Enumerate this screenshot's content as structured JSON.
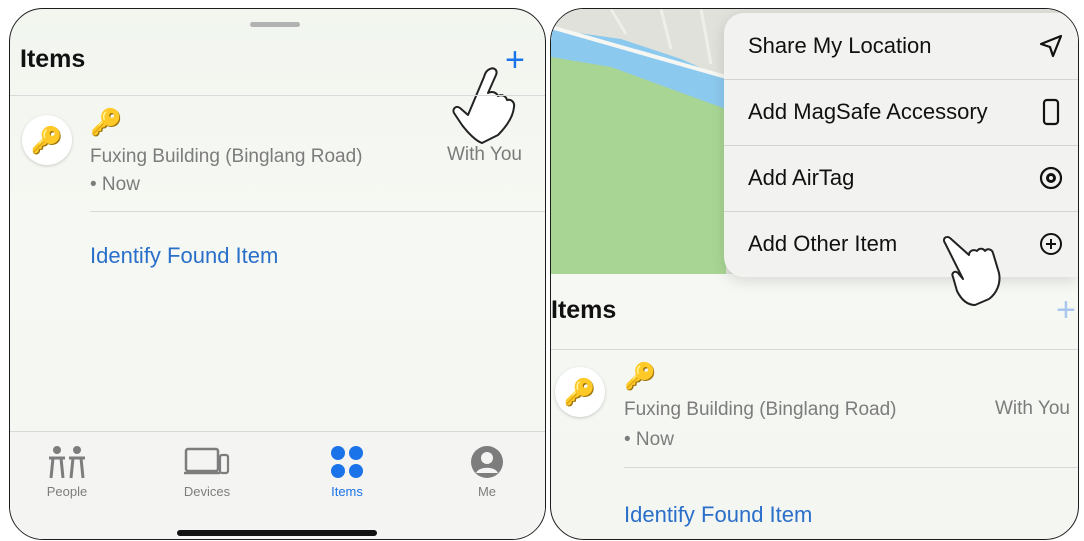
{
  "left": {
    "title": "Items",
    "item": {
      "emoji": "🔑",
      "location": "Fuxing Building (Binglang Road)",
      "time": "• Now",
      "status": "With You"
    },
    "identify_link": "Identify Found Item",
    "tabs": [
      {
        "label": "People",
        "icon": "people-icon"
      },
      {
        "label": "Devices",
        "icon": "devices-icon"
      },
      {
        "label": "Items",
        "icon": "items-icon"
      },
      {
        "label": "Me",
        "icon": "person-icon"
      }
    ],
    "active_tab": "Items"
  },
  "right": {
    "menu": [
      {
        "label": "Share My Location",
        "icon": "location-arrow-icon"
      },
      {
        "label": "Add MagSafe Accessory",
        "icon": "phone-icon"
      },
      {
        "label": "Add AirTag",
        "icon": "airtag-icon"
      },
      {
        "label": "Add Other Item",
        "icon": "plus-circle-icon"
      }
    ],
    "title": "Items",
    "item": {
      "emoji": "🔑",
      "location": "Fuxing Building (Binglang Road)",
      "time": "• Now",
      "status": "With You"
    },
    "identify_link": "Identify Found Item"
  },
  "colors": {
    "accent": "#1a73e8",
    "link": "#2a6fc9",
    "secondary_text": "#7c7c7c",
    "map_green": "#a8d594",
    "map_water": "#8cc9ee"
  }
}
